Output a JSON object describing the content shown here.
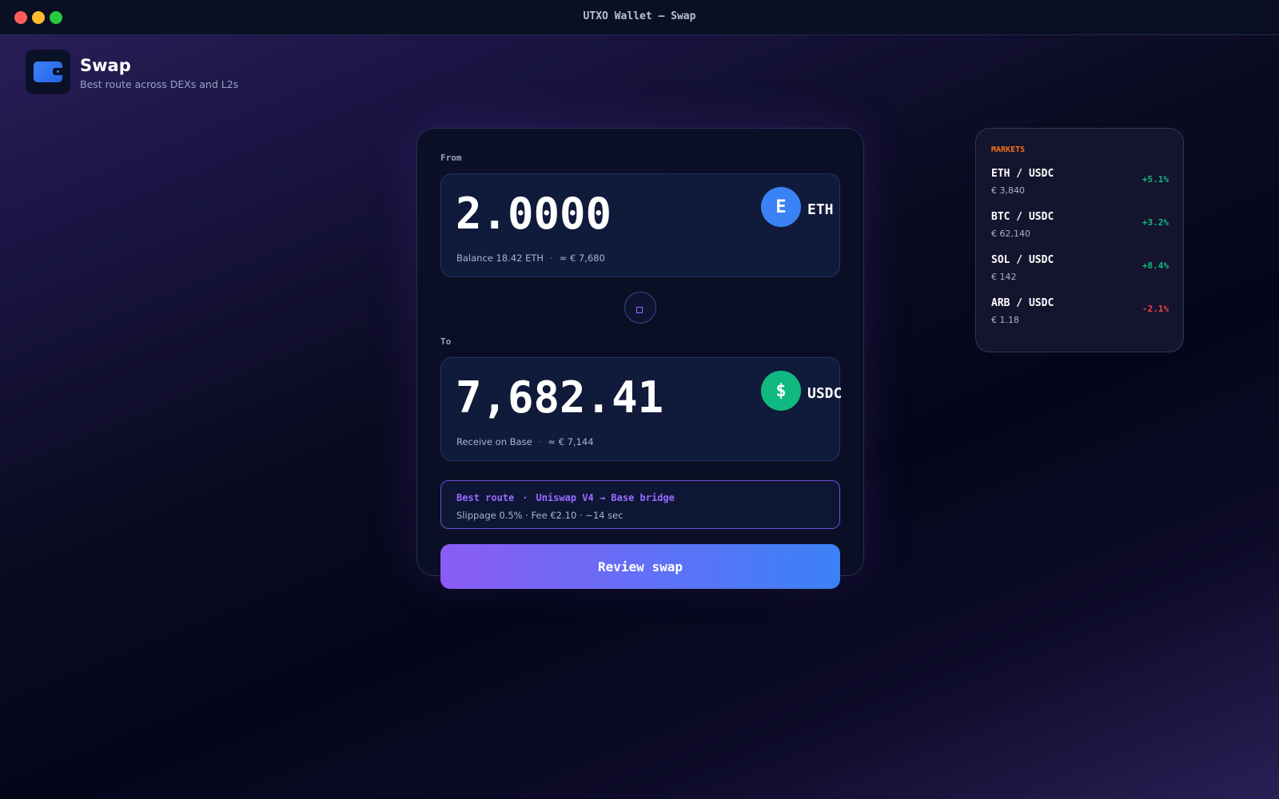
{
  "window": {
    "title": "UTXO Wallet — Swap"
  },
  "header": {
    "title": "Swap",
    "subtitle": "Best route across DEXs and L2s"
  },
  "swap": {
    "from": {
      "label": "From",
      "amount": "2.0000",
      "token_symbol": "ETH",
      "token_glyph": "E",
      "token_color": "#3b82f6",
      "balance": "Balance 18.42 ETH",
      "separator": "·",
      "fiat": "≈ € 7,680"
    },
    "to": {
      "label": "To",
      "amount": "7,682.41",
      "token_symbol": "USDC",
      "token_glyph": "$",
      "token_color": "#10b981",
      "network": "Receive on Base",
      "separator": "·",
      "fiat": "≈ € 7,144"
    },
    "route": {
      "title": "Best route",
      "separator": "·",
      "path": "Uniswap V4 → Base bridge",
      "details": "Slippage 0.5% · Fee €2.10 · ~14 sec"
    },
    "review_label": "Review swap"
  },
  "markets": {
    "title": "MARKETS",
    "items": [
      {
        "pair": "ETH / USDC",
        "price": "€ 3,840",
        "change": "+5.1%",
        "color": "#10b981"
      },
      {
        "pair": "BTC / USDC",
        "price": "€ 62,140",
        "change": "+3.2%",
        "color": "#10b981"
      },
      {
        "pair": "SOL / USDC",
        "price": "€ 142",
        "change": "+8.4%",
        "color": "#10b981"
      },
      {
        "pair": "ARB / USDC",
        "price": "€ 1.18",
        "change": "-2.1%",
        "color": "#ef4444"
      }
    ]
  }
}
